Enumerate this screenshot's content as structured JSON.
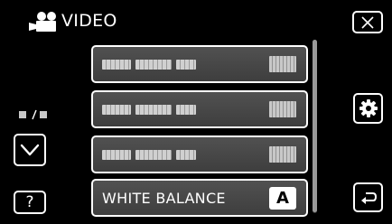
{
  "header": {
    "title": "VIDEO",
    "icon": "video-camera-icon"
  },
  "menu": {
    "items": [
      {
        "label": "",
        "value": "",
        "redacted": true
      },
      {
        "label": "",
        "value": "",
        "redacted": true
      },
      {
        "label": "",
        "value": "",
        "redacted": true
      },
      {
        "label": "WHITE BALANCE",
        "value": "A",
        "redacted": false
      }
    ]
  },
  "controls": {
    "help_label": "?",
    "close_icon": "close-icon",
    "settings_icon": "gear-icon",
    "back_icon": "return-icon",
    "down_icon": "chevron-down-icon"
  },
  "colors": {
    "background": "#000000",
    "item_fill": "#4a4a4a",
    "border": "#ffffff"
  }
}
